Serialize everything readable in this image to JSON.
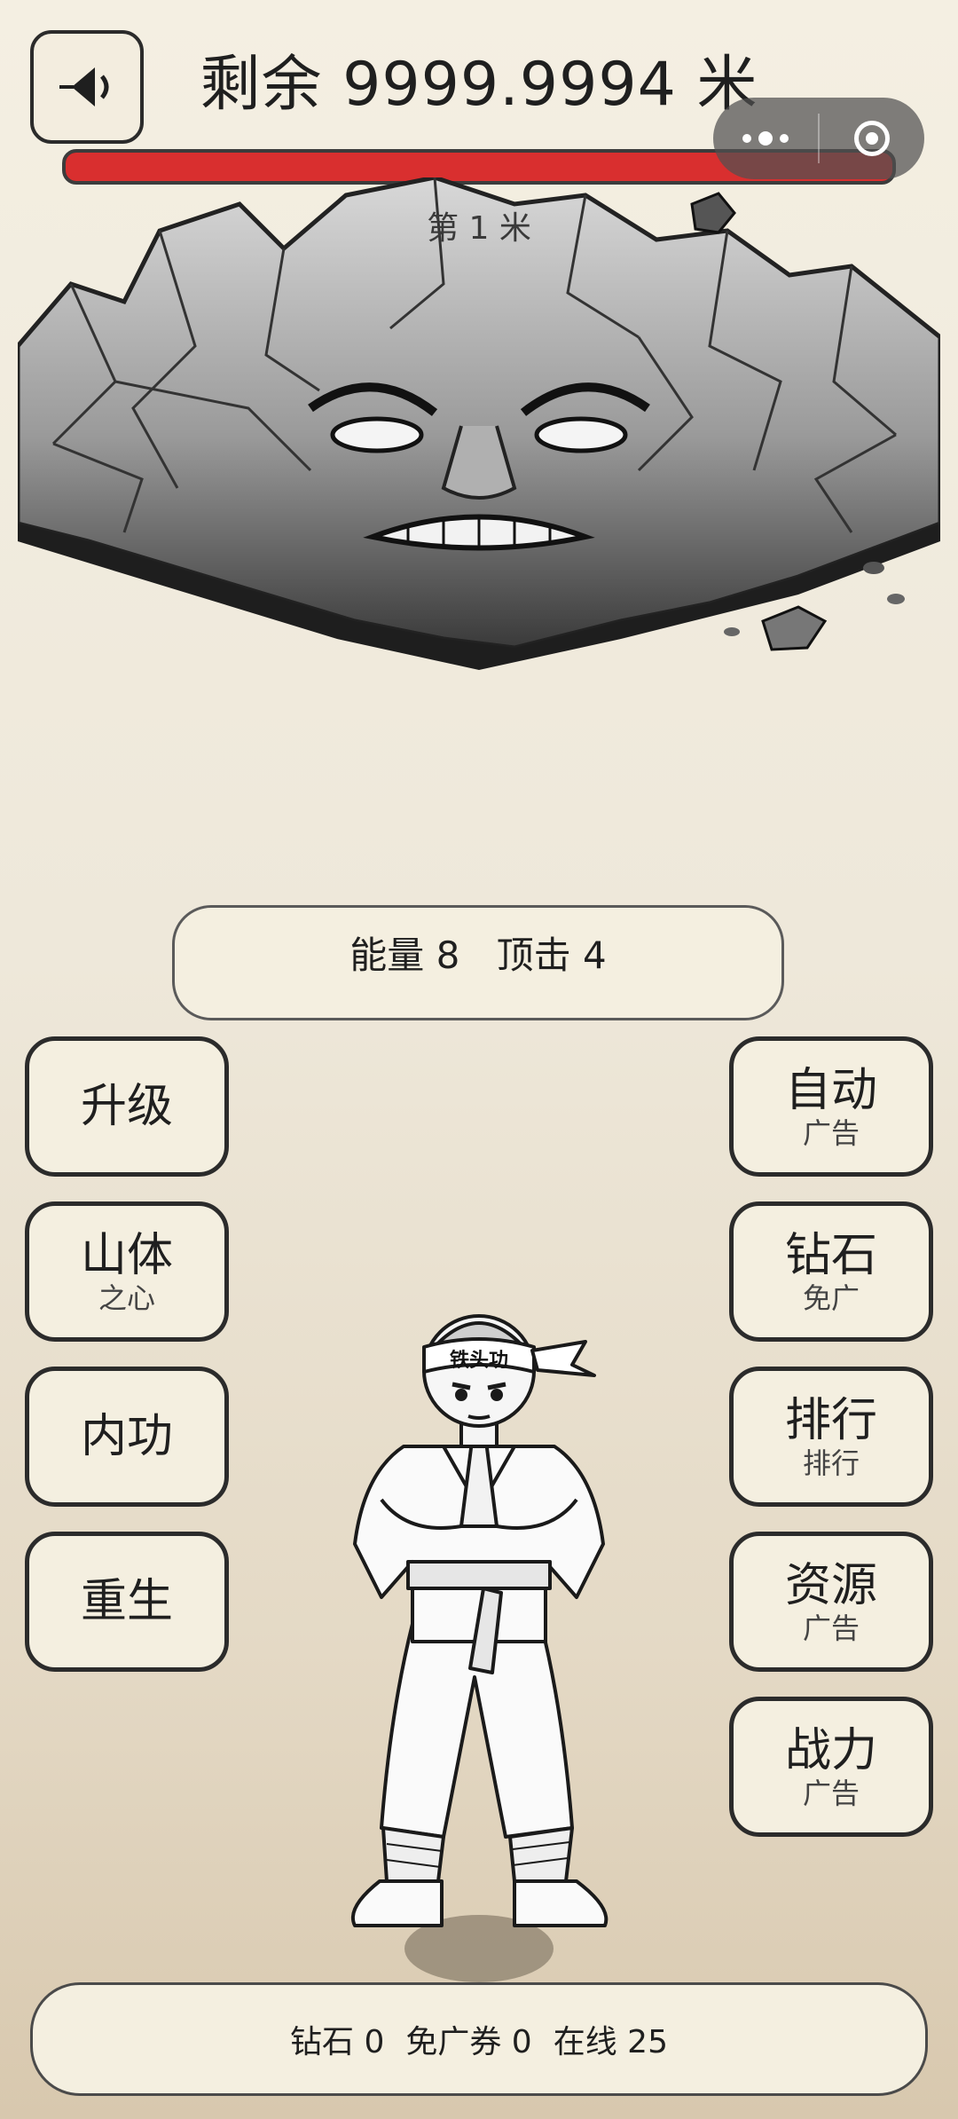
{
  "header": {
    "title": "剩余 9999.9994 米",
    "sound_icon": "speaker-icon",
    "hp_fraction": 0.9999
  },
  "capsule": {
    "menu_icon": "more-dots-icon",
    "close_icon": "target-close-icon"
  },
  "boulder": {
    "meter_label": "第 1 米"
  },
  "stats": {
    "energy": "能量 8",
    "hits": "顶击 4"
  },
  "left_buttons": [
    {
      "label": "升级",
      "sub": ""
    },
    {
      "label": "山体",
      "sub": "之心"
    },
    {
      "label": "内功",
      "sub": ""
    },
    {
      "label": "重生",
      "sub": ""
    }
  ],
  "right_buttons": [
    {
      "label": "自动",
      "sub": "广告"
    },
    {
      "label": "钻石",
      "sub": "免广"
    },
    {
      "label": "排行",
      "sub": "排行"
    },
    {
      "label": "资源",
      "sub": "广告"
    },
    {
      "label": "战力",
      "sub": "广告"
    }
  ],
  "character": {
    "headband_text": "铁头功"
  },
  "footer": {
    "diamonds": "钻石 0",
    "ad_tickets": "免广券 0",
    "online": "在线 25"
  },
  "colors": {
    "hp_fill": "#d92f2f",
    "panel_bg": "#f4efe0",
    "border": "#2b2b2b"
  }
}
